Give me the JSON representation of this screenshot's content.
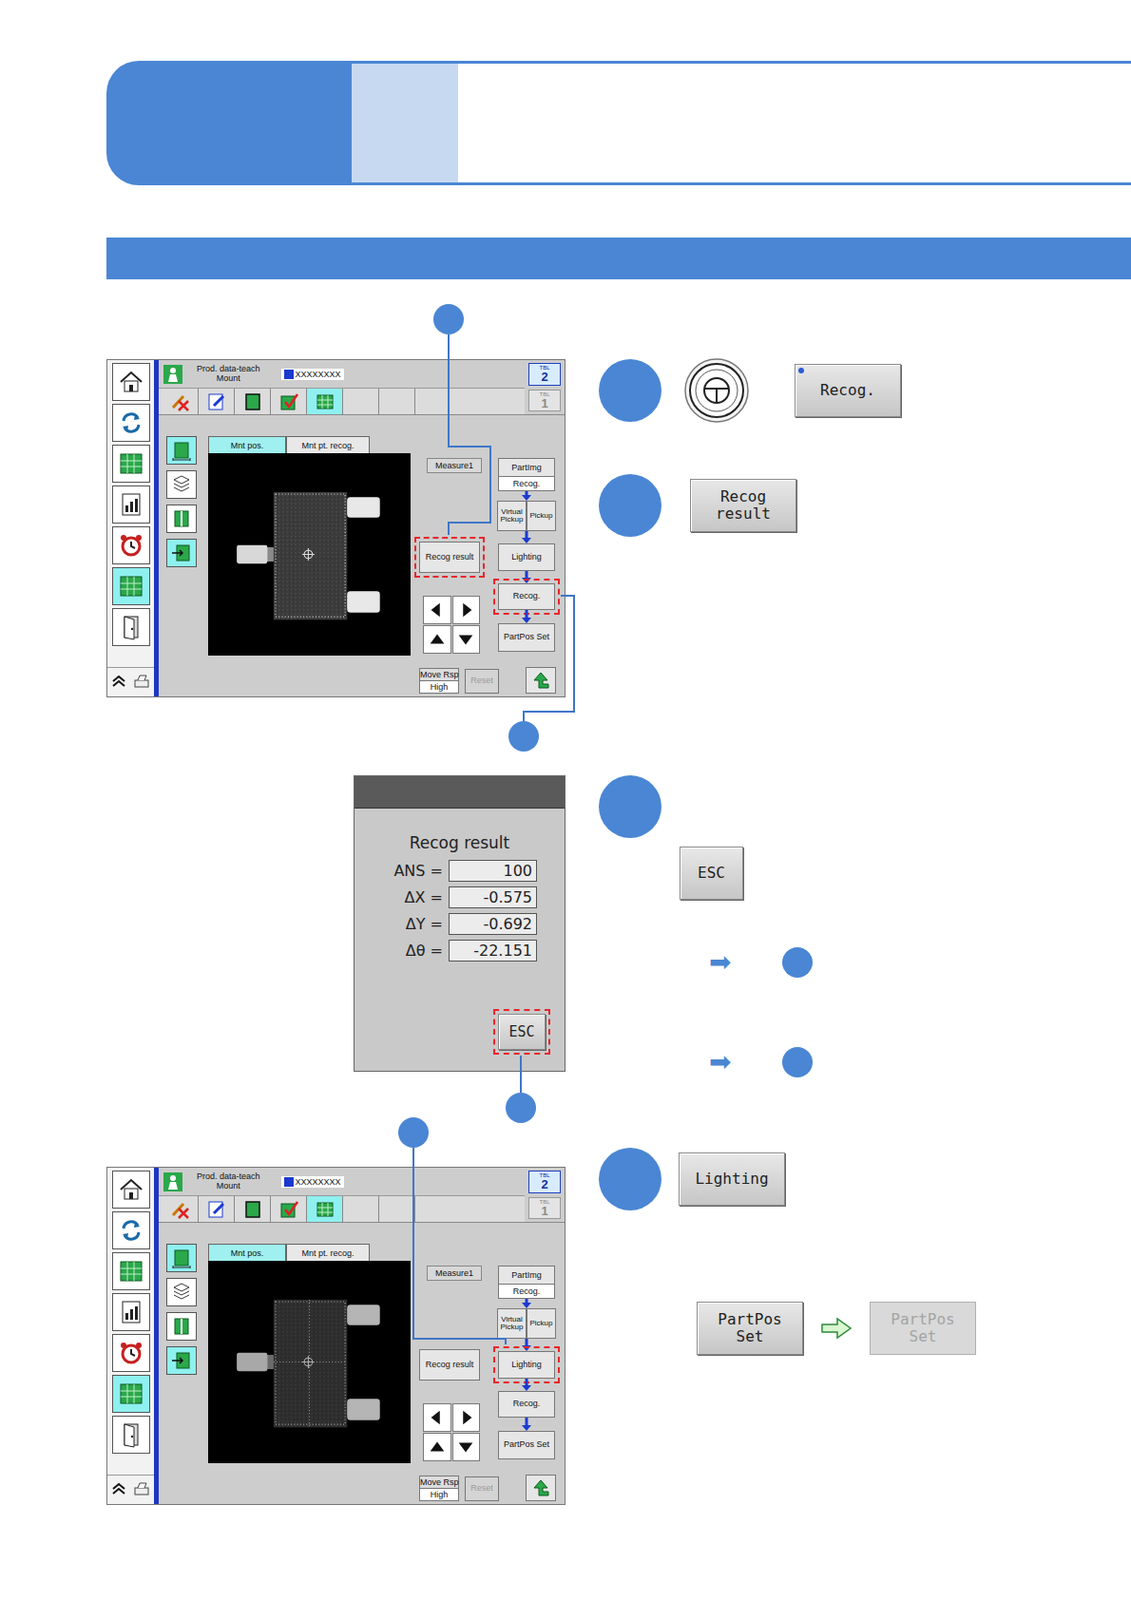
{
  "screens": [
    {
      "title": "Prod. data-teach",
      "subtitle": "Mount",
      "file": "XXXXXXXX",
      "tables": [
        {
          "label": "TBL",
          "number": "2",
          "selected": true
        },
        {
          "label": "TBL",
          "number": "1",
          "selected": false
        }
      ],
      "sidebar": [
        {
          "selected": false
        },
        {
          "selected": false
        },
        {
          "selected": false
        },
        {
          "selected": false
        },
        {
          "selected": false
        },
        {
          "selected": true
        },
        {
          "selected": false
        }
      ],
      "toolbar": [
        {
          "selected": false
        },
        {
          "selected": false
        },
        {
          "selected": false
        },
        {
          "selected": false
        },
        {
          "selected": true
        },
        {
          "selected": false
        },
        {
          "selected": false
        }
      ],
      "tools": [
        {
          "selected": true
        },
        {
          "selected": false
        },
        {
          "selected": false
        },
        {
          "selected": true
        }
      ],
      "tabs": [
        {
          "label": "Mnt pos.",
          "selected": true
        },
        {
          "label": "Mnt pt. recog.",
          "selected": false
        }
      ],
      "measure": "Measure1",
      "recog_result": {
        "label": "Recog result",
        "highlighted": true
      },
      "flow": [
        {
          "kind": "select",
          "label": "PartImg",
          "value": "Recog.",
          "highlighted": false
        },
        {
          "kind": "pair",
          "label": "Virtual Pickup",
          "second": "Pickup",
          "highlighted": false
        },
        {
          "kind": "button",
          "label": "Lighting",
          "highlighted": false
        },
        {
          "kind": "button",
          "label": "Recog.",
          "highlighted": true
        },
        {
          "kind": "button",
          "label": "PartPos Set",
          "highlighted": false
        }
      ],
      "move": {
        "label": "Move Rsp",
        "value": "High"
      },
      "reset": {
        "label": "Reset",
        "disabled": true
      },
      "camera": {
        "dimmed": false
      }
    },
    {
      "title": "Prod. data-teach",
      "subtitle": "Mount",
      "file": "XXXXXXXX",
      "tables": [
        {
          "label": "TBL",
          "number": "2",
          "selected": true
        },
        {
          "label": "TBL",
          "number": "1",
          "selected": false
        }
      ],
      "sidebar": [
        {
          "selected": false
        },
        {
          "selected": false
        },
        {
          "selected": false
        },
        {
          "selected": false
        },
        {
          "selected": false
        },
        {
          "selected": true
        },
        {
          "selected": false
        }
      ],
      "toolbar": [
        {
          "selected": false
        },
        {
          "selected": false
        },
        {
          "selected": false
        },
        {
          "selected": false
        },
        {
          "selected": true
        },
        {
          "selected": false
        },
        {
          "selected": false
        }
      ],
      "tools": [
        {
          "selected": true
        },
        {
          "selected": false
        },
        {
          "selected": false
        },
        {
          "selected": true
        }
      ],
      "tabs": [
        {
          "label": "Mnt pos.",
          "selected": true
        },
        {
          "label": "Mnt pt. recog.",
          "selected": false
        }
      ],
      "measure": "Measure1",
      "recog_result": {
        "label": "Recog result",
        "highlighted": false
      },
      "flow": [
        {
          "kind": "select",
          "label": "PartImg",
          "value": "Recog.",
          "highlighted": false
        },
        {
          "kind": "pair",
          "label": "Virtual Pickup",
          "second": "Pickup",
          "highlighted": false
        },
        {
          "kind": "button",
          "label": "Lighting",
          "highlighted": true
        },
        {
          "kind": "button",
          "label": "Recog.",
          "highlighted": false
        },
        {
          "kind": "button",
          "label": "PartPos Set",
          "highlighted": false
        }
      ],
      "move": {
        "label": "Move Rsp",
        "value": "High"
      },
      "reset": {
        "label": "Reset",
        "disabled": true
      },
      "camera": {
        "dimmed": true
      }
    }
  ],
  "dialog": {
    "heading": "Recog result",
    "separator": "=",
    "rows": [
      {
        "label": "ANS",
        "value": "100"
      },
      {
        "label": "ΔX",
        "value": "-0.575"
      },
      {
        "label": "ΔY",
        "value": "-0.692"
      },
      {
        "label": "Δθ",
        "value": "-22.151"
      }
    ],
    "button": {
      "label": "ESC",
      "highlighted": true
    }
  },
  "steps": [
    {
      "kind": "trigger",
      "button": {
        "label": "Recog.",
        "marked": true
      }
    },
    {
      "kind": "open",
      "button": {
        "label": "Recog result"
      }
    },
    {
      "kind": "close",
      "button": {
        "label": "ESC"
      },
      "branches": [
        {
          "arrow": "➡"
        },
        {
          "arrow": "➡"
        }
      ]
    },
    {
      "kind": "adjust",
      "button": {
        "label": "Lighting"
      },
      "transition": {
        "from": "PartPos Set",
        "to": "PartPos Set",
        "to_disabled": true
      }
    }
  ]
}
